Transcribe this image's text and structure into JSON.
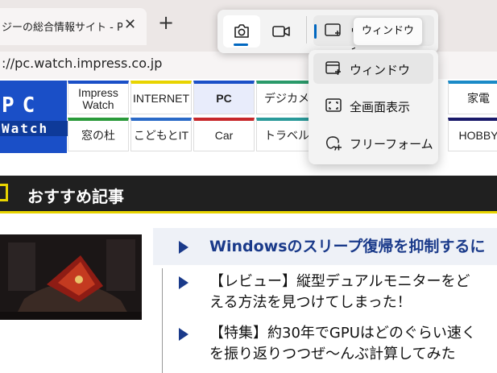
{
  "browser": {
    "tab_title": "ジーの総合情報サイト - P",
    "tab_close": "✕",
    "new_tab": "+",
    "url": "://pc.watch.impress.co.jp"
  },
  "site": {
    "logo_top": "PC",
    "logo_bottom": "Watch",
    "nav_row1": [
      "Impress Watch",
      "INTERNET",
      "PC",
      "デジカメ",
      "家電"
    ],
    "nav_row2": [
      "窓の杜",
      "こどもとIT",
      "Car",
      "トラベル",
      "HOBBY"
    ],
    "section_title": "おすすめ記事",
    "articles": [
      "Windowsのスリープ復帰を抑制するに",
      "【レビュー】縦型デュアルモニターをど",
      "える方法を見つけてしまった！",
      "【特集】約30年でGPUはどのぐらい速く",
      "を振り返りつつぜ～んぶ計算してみた"
    ]
  },
  "snipping_tool": {
    "current_mode_label": "ウィンドウ",
    "tooltip": "ウィンドウ",
    "menu": [
      "ウィンドウ",
      "全画面表示",
      "フリーフォーム"
    ],
    "accent_color": "#0067c0"
  }
}
